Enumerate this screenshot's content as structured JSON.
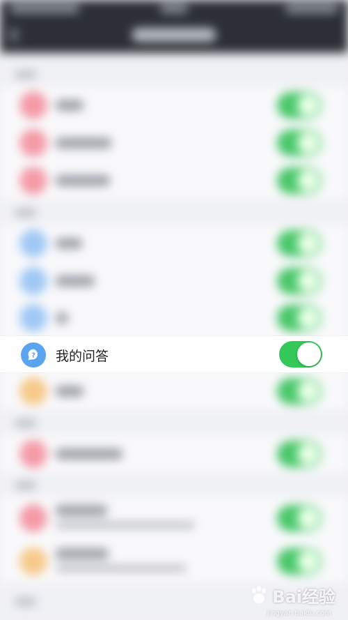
{
  "focused_row": {
    "label": "我的问答",
    "toggle_on": true,
    "icon": "question-bubble-icon"
  },
  "colors": {
    "toggle_on": "#34c759",
    "question_icon": "#5aa3ee",
    "page_background": "#eff0f4"
  },
  "watermark": {
    "brand": "Bai经验",
    "sub": "jingyan.baidu.com"
  }
}
